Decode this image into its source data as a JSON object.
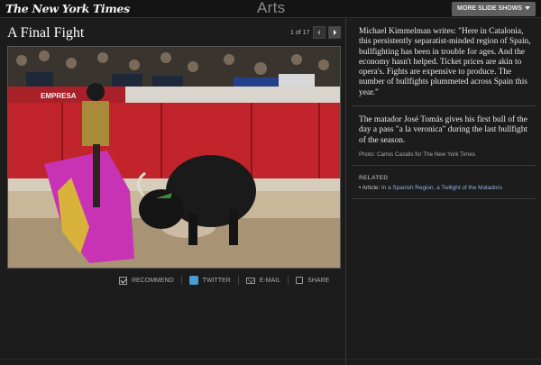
{
  "header": {
    "logo_text": "The New York Times",
    "section_title": "Arts",
    "more_button_label": "MORE SLIDE SHOWS"
  },
  "slide": {
    "title": "A Final Fight",
    "counter": "1 of 17",
    "photo_signage": "EMPRESA"
  },
  "share": {
    "recommend": "RECOMMEND",
    "twitter": "TWITTER",
    "email": "E-MAIL",
    "share": "SHARE"
  },
  "sidebar": {
    "quote": "Michael Kimmelman writes: \"Here in Catalonia, this persistently separatist-minded region of Spain, bullfighting has been in trouble for ages. And the economy hasn't helped. Ticket prices are akin to opera's. Fights are expensive to produce. The number of bullfights plummeted across Spain this year.\"",
    "caption": "The matador José Tomás gives his first bull of the day a pass \"a la veronica\" during the last bullfight of the season.",
    "credit": "Photo: Carlos Cazalis for The New York Times",
    "related_heading": "RELATED",
    "related_prefix": "• Article:",
    "related_link": "In a Spanish Region, a Twilight of the Matadors"
  },
  "colors": {
    "background": "#1c1c1c",
    "barrier_red": "#c2242c",
    "cape_magenta": "#c832b4",
    "link_blue": "#8fb4da"
  }
}
